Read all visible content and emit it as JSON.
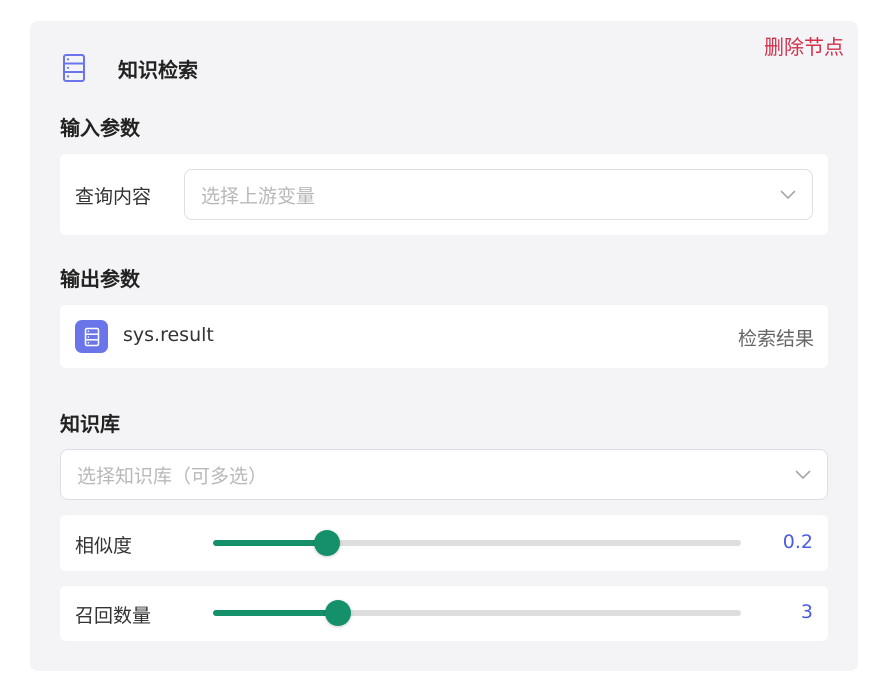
{
  "node": {
    "title": "知识检索",
    "delete_label": "删除节点",
    "icon": "database-icon",
    "accent_color": "#6a75e9"
  },
  "input_section": {
    "title": "输入参数",
    "query_label": "查询内容",
    "query_placeholder": "选择上游变量"
  },
  "output_section": {
    "title": "输出参数",
    "variable_name": "sys.result",
    "variable_desc": "检索结果",
    "icon": "database-icon"
  },
  "knowledge_section": {
    "title": "知识库",
    "select_placeholder": "选择知识库（可多选）"
  },
  "similarity": {
    "label": "相似度",
    "value": "0.2",
    "fill_fraction": 0.216
  },
  "recall_count": {
    "label": "召回数量",
    "value": "3",
    "fill_fraction": 0.237
  },
  "colors": {
    "slider_active": "#14906a",
    "value_text": "#4b5ce4",
    "delete_text": "#d0314b"
  }
}
